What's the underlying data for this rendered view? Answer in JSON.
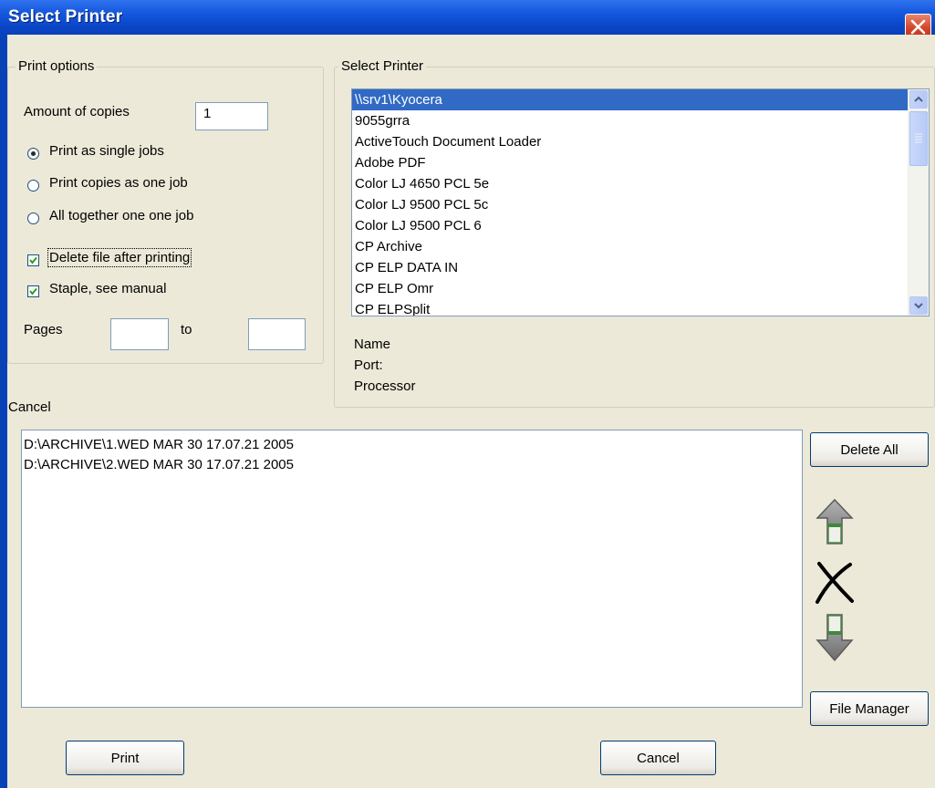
{
  "window": {
    "title": "Select Printer"
  },
  "print_options": {
    "group_title": "Print options",
    "copies_label": "Amount of copies",
    "copies_value": "1",
    "radio_single": "Print as single jobs",
    "radio_copies_one": "Print copies as one job",
    "radio_all_together": "All together one one job",
    "selected_radio": "Print as single jobs",
    "delete_after_label": "Delete file after printing",
    "delete_after_checked": true,
    "staple_label": "Staple, see manual",
    "staple_checked": true,
    "pages_label": "Pages",
    "pages_from": "",
    "to_label": "to",
    "pages_to": ""
  },
  "select_printer": {
    "group_title": "Select Printer",
    "printers": [
      "\\\\srv1\\Kyocera",
      "9055grra",
      "ActiveTouch Document Loader",
      "Adobe PDF",
      "Color LJ 4650 PCL 5e",
      "Color LJ 9500 PCL 5c",
      "Color LJ 9500 PCL 6",
      "CP Archive",
      "CP ELP DATA IN",
      "CP ELP Omr",
      "CP ELPSplit"
    ],
    "selected_printer": "\\\\srv1\\Kyocera",
    "name_label": "Name",
    "port_label": "Port:",
    "processor_label": "Processor"
  },
  "cancel_section": {
    "label": "Cancel",
    "jobs": [
      "D:\\ARCHIVE\\1.WED MAR 30 17.07.21 2005",
      "D:\\ARCHIVE\\2.WED MAR 30 17.07.21 2005"
    ],
    "delete_all_label": "Delete All",
    "file_manager_label": "File Manager"
  },
  "footer": {
    "print_label": "Print",
    "cancel_label": "Cancel"
  },
  "icons": {
    "close": "close-icon",
    "move_up": "arrow-up-icon",
    "remove": "x-delete-icon",
    "move_down": "arrow-down-icon"
  }
}
